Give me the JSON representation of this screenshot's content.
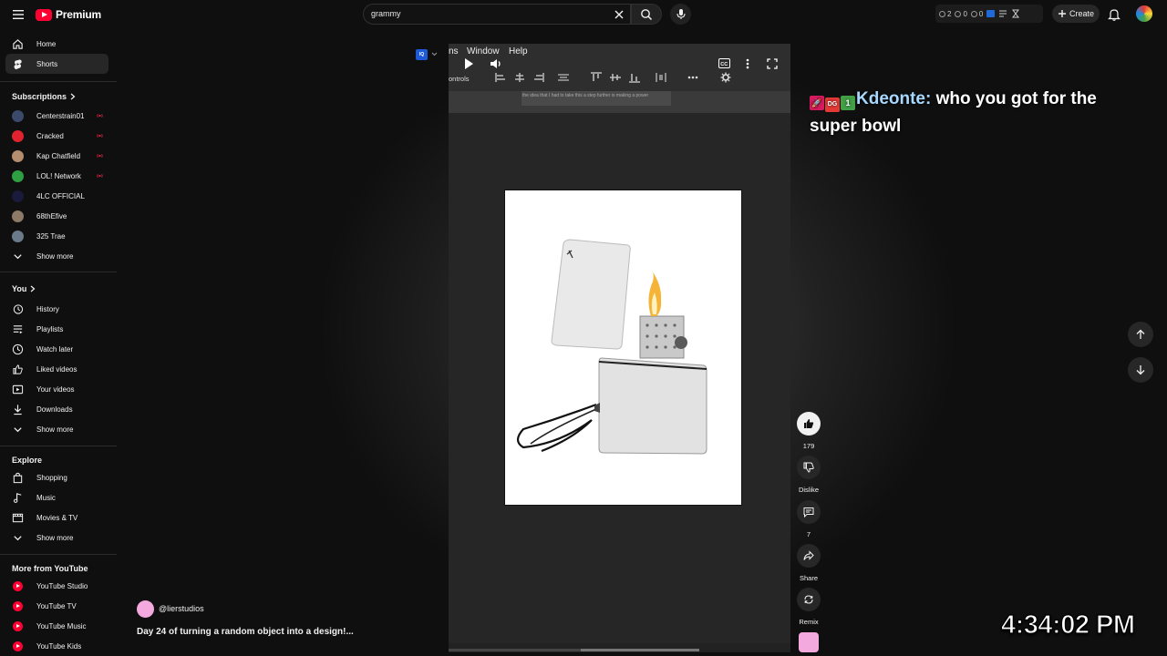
{
  "header": {
    "logo_text": "Premium",
    "search_value": "grammy",
    "extension": {
      "count_a": "2",
      "count_b": "0",
      "count_c": "0"
    },
    "create_label": "Create"
  },
  "sidebar": {
    "main": [
      {
        "label": "Home",
        "icon": "home-icon"
      },
      {
        "label": "Shorts",
        "icon": "shorts-icon",
        "active": true
      }
    ],
    "subscriptions_title": "Subscriptions",
    "subscriptions": [
      {
        "label": "Centerstrain01",
        "live": true,
        "color": "#3b4a6b"
      },
      {
        "label": "Cracked",
        "live": true,
        "color": "#e0232e"
      },
      {
        "label": "Kap Chatfield",
        "live": true,
        "color": "#b48c6e"
      },
      {
        "label": "LOL! Network",
        "live": true,
        "color": "#2ea043"
      },
      {
        "label": "4LC OFFICIAL",
        "live": false,
        "color": "#1a1a3a"
      },
      {
        "label": "68thEfive",
        "live": false,
        "color": "#8c7a66"
      },
      {
        "label": "325 Trae",
        "live": false,
        "color": "#6a7a8a"
      }
    ],
    "subs_show_more": "Show more",
    "you_title": "You",
    "you": [
      {
        "label": "History",
        "icon": "history-icon"
      },
      {
        "label": "Playlists",
        "icon": "playlists-icon"
      },
      {
        "label": "Watch later",
        "icon": "watch-later-icon"
      },
      {
        "label": "Liked videos",
        "icon": "like-icon"
      },
      {
        "label": "Your videos",
        "icon": "your-videos-icon"
      },
      {
        "label": "Downloads",
        "icon": "download-icon"
      }
    ],
    "you_show_more": "Show more",
    "explore_title": "Explore",
    "explore": [
      {
        "label": "Shopping",
        "icon": "shopping-icon"
      },
      {
        "label": "Music",
        "icon": "music-icon"
      },
      {
        "label": "Movies & TV",
        "icon": "movies-icon"
      }
    ],
    "explore_show_more": "Show more",
    "more_title": "More from YouTube",
    "more": [
      {
        "label": "YouTube Studio"
      },
      {
        "label": "YouTube TV"
      },
      {
        "label": "YouTube Music"
      },
      {
        "label": "YouTube Kids"
      }
    ]
  },
  "video": {
    "menu_items": [
      "ns",
      "Window",
      "Help"
    ],
    "controls_label": "ontrols",
    "caption_text": "the idea that I had to take this a step further is making a power",
    "channel": "@lierstudios",
    "title": "Day 24 of turning a random object into a design!..."
  },
  "actions": {
    "likes": "179",
    "dislike": "Dislike",
    "comments": "7",
    "share": "Share",
    "remix": "Remix"
  },
  "chat": {
    "badges": [
      "🚀",
      "DG",
      "1"
    ],
    "user": "Kdeonte:",
    "message": "who you got for the super bowl"
  },
  "clock": "4:34:02 PM",
  "colors": {
    "accent": "#ff0033",
    "background": "#0f0f0f",
    "surface": "#272727"
  }
}
